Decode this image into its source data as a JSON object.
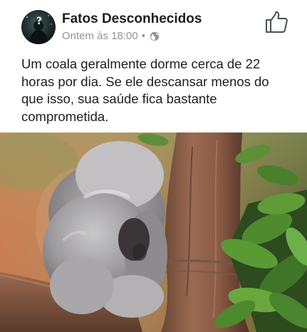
{
  "post": {
    "page_name": "Fatos Desconhecidos",
    "timestamp": "Ontem às 18:00",
    "separator": "•",
    "privacy_icon": "globe-icon",
    "like_icon": "thumbs-up-icon",
    "text": "Um coala geralmente dorme cerca de 22 horas por dia. Se ele descansar menos do que isso, sua saúde fica bastante comprometida.",
    "image": {
      "subject": "koala-sleeping-on-tree-icon"
    }
  },
  "colors": {
    "name": "#1c1e21",
    "meta": "#90949c",
    "text": "#1c1e21"
  }
}
